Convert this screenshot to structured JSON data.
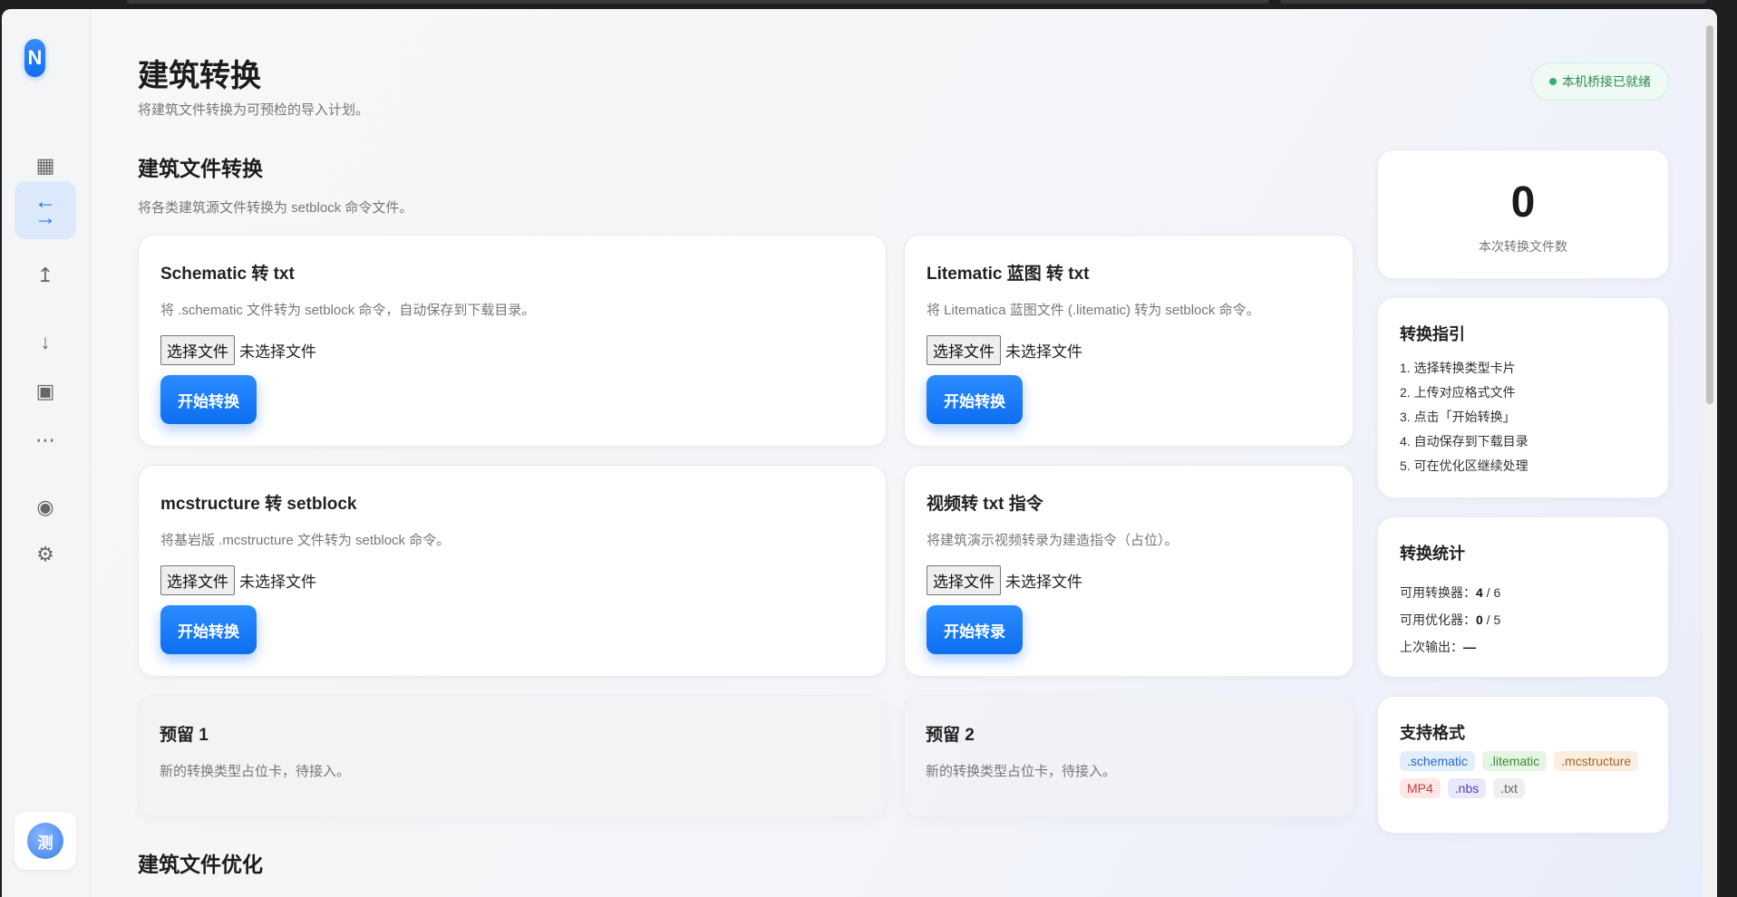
{
  "logo": {
    "letter": "N"
  },
  "header": {
    "title": "建筑转换",
    "subtitle": "将建筑文件转换为可预检的导入计划。",
    "status": "本机桥接已就绪"
  },
  "sidebar": {
    "items": [
      {
        "icon": "▦",
        "name": "grid-icon"
      },
      {
        "icon": "⇄",
        "name": "convert-icon",
        "active": true
      },
      {
        "icon": "↥",
        "name": "upload-icon"
      },
      {
        "icon": "↓",
        "name": "download-icon"
      },
      {
        "icon": "▣",
        "name": "box-icon"
      },
      {
        "icon": "⋯",
        "name": "more-icon"
      },
      {
        "icon": "◉",
        "name": "record-icon"
      },
      {
        "icon": "⚙",
        "name": "gear-icon"
      }
    ],
    "avatar": "测"
  },
  "section1": {
    "title": "建筑文件转换",
    "desc": "将各类建筑源文件转换为 setblock 命令文件。"
  },
  "section2": {
    "title": "建筑文件优化"
  },
  "file_input": {
    "button": "选择文件",
    "status": "未选择文件"
  },
  "cards": [
    {
      "title": "Schematic 转 txt",
      "desc": "将 .schematic 文件转为 setblock 命令，自动保存到下载目录。",
      "action": "开始转换"
    },
    {
      "title": "Litematic 蓝图 转 txt",
      "desc": "将 Litematica 蓝图文件 (.litematic) 转为 setblock 命令。",
      "action": "开始转换"
    },
    {
      "title": "mcstructure 转 setblock",
      "desc": "将基岩版 .mcstructure 文件转为 setblock 命令。",
      "action": "开始转换"
    },
    {
      "title": "视频转 txt 指令",
      "desc": "将建筑演示视频转录为建造指令（占位）。",
      "action": "开始转录"
    }
  ],
  "placeholders": [
    {
      "title": "预留 1",
      "desc": "新的转换类型占位卡，待接入。"
    },
    {
      "title": "预留 2",
      "desc": "新的转换类型占位卡，待接入。"
    }
  ],
  "counter": {
    "value": "0",
    "label": "本次转换文件数"
  },
  "guide": {
    "title": "转换指引",
    "steps": [
      "1. 选择转换类型卡片",
      "2. 上传对应格式文件",
      "3. 点击「开始转换」",
      "4. 自动保存到下载目录",
      "5. 可在优化区继续处理"
    ]
  },
  "stats": {
    "title": "转换统计",
    "converters_label": "可用转换器：",
    "converters_value": "4",
    "converters_total": " / 6",
    "optimizers_label": "可用优化器：",
    "optimizers_value": "0",
    "optimizers_total": " / 5",
    "last_label": "上次输出：",
    "last_value": "—"
  },
  "formats": {
    "title": "支持格式",
    "tags": [
      {
        "text": ".schematic",
        "bg": "#e3eefc",
        "fg": "#2a6bc4"
      },
      {
        "text": ".litematic",
        "bg": "#e6f4e4",
        "fg": "#3b8a35"
      },
      {
        "text": ".mcstructure",
        "bg": "#fbeee0",
        "fg": "#a46424"
      },
      {
        "text": "MP4",
        "bg": "#fde6e6",
        "fg": "#c23c3c"
      },
      {
        "text": ".nbs",
        "bg": "#e9e8fb",
        "fg": "#5046b8"
      },
      {
        "text": ".txt",
        "bg": "#efefef",
        "fg": "#666666"
      }
    ]
  }
}
